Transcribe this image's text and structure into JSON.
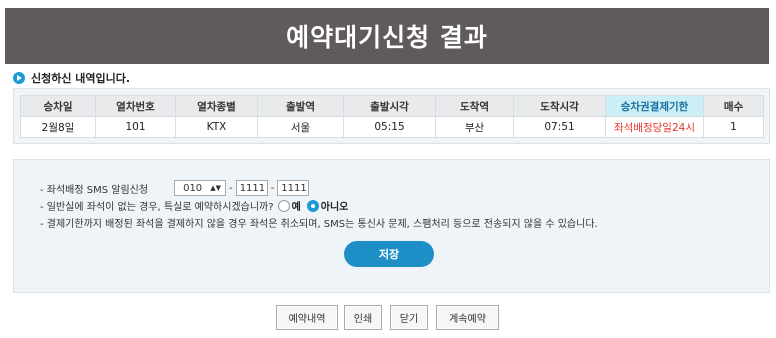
{
  "header": {
    "title": "예약대기신청 결과"
  },
  "section": {
    "label": "신청하신 내역입니다."
  },
  "table": {
    "headers": [
      "승차일",
      "열차번호",
      "열차종별",
      "출발역",
      "출발시각",
      "도착역",
      "도착시각",
      "승차권결제기한",
      "매수"
    ],
    "row": [
      "2월8일",
      "101",
      "KTX",
      "서울",
      "05:15",
      "부산",
      "07:51",
      "좌석배정당일24시",
      "1"
    ]
  },
  "form": {
    "sms_label": "- 좌석배정 SMS 알림신청",
    "phone_prefix": "010",
    "phone_mid": "1111",
    "phone_last": "1111",
    "dash": "-",
    "special_question": "- 일반실에 좌석이 없는 경우, 특실로 예약하시겠습니까?",
    "yes_label": "예",
    "no_label": "아니오",
    "selected_option": "아니오",
    "notice": "- 결제기한까지 배정된 좌석을 결제하지 않을 경우 좌석은 취소되며, SMS는 통신사 문제, 스팸처리 등으로 전송되지 않을 수 있습니다.",
    "save_label": "저장"
  },
  "buttons": {
    "history": "예약내역",
    "print": "인쇄",
    "close": "닫기",
    "continue": "계속예약"
  },
  "colors": {
    "header_bg": "#5f5b5a",
    "accent": "#1d8fc6",
    "deadline": "#e8322c",
    "panel_bg": "#eef4f8"
  }
}
